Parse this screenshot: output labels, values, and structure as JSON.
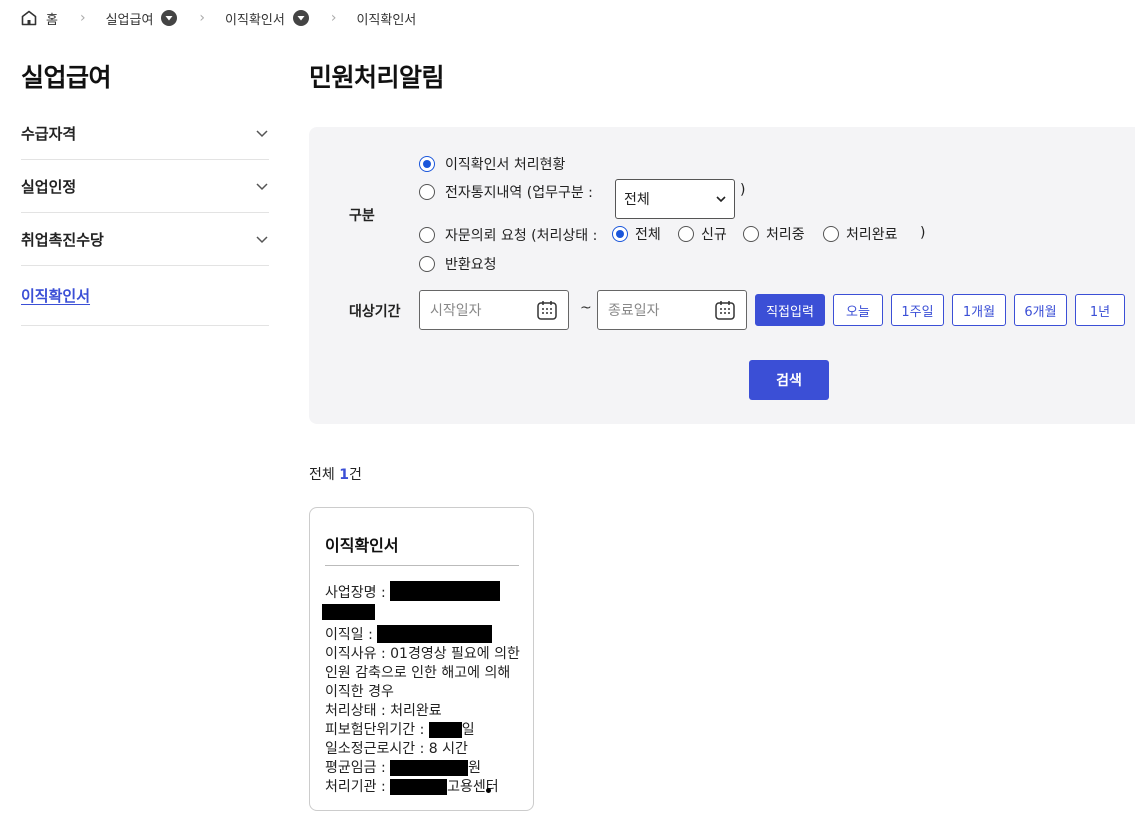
{
  "breadcrumb": {
    "home": "홈",
    "level1": "실업급여",
    "level2": "이직확인서",
    "current": "이직확인서"
  },
  "sidebar": {
    "title": "실업급여",
    "items": [
      {
        "label": "수급자격"
      },
      {
        "label": "실업인정"
      },
      {
        "label": "취업촉진수당"
      },
      {
        "label": "이직확인서"
      }
    ]
  },
  "main": {
    "title": "민원처리알림",
    "search": {
      "category_label": "구분",
      "opt1": "이직확인서 처리현황",
      "opt2_prefix": "전자통지내역 (업무구분 :",
      "opt2_select": "전체",
      "opt2_suffix": ")",
      "opt3_prefix": "자문의뢰 요청 (처리상태 :",
      "sub_all": "전체",
      "sub_new": "신규",
      "sub_progress": "처리중",
      "sub_done": "처리완료",
      "opt3_suffix": ")",
      "opt4": "반환요청",
      "period_label": "대상기간",
      "start_placeholder": "시작일자",
      "tilde": "~",
      "end_placeholder": "종료일자",
      "btn_direct": "직접입력",
      "btn_today": "오늘",
      "btn_1w": "1주일",
      "btn_1m": "1개월",
      "btn_6m": "6개월",
      "btn_1y": "1년",
      "search_btn": "검색"
    },
    "total_prefix": "전체 ",
    "total_count": "1",
    "total_suffix": "건",
    "card": {
      "title": "이직확인서",
      "biz_label": "사업장명 :",
      "retire_label": "이직일 :",
      "reason": "이직사유 : 01경영상 필요에 의한 인원 감축으로 인한 해고에 의해 이직한 경우",
      "status": "처리상태 : 처리완료",
      "insured_label": "피보험단위기간 :",
      "insured_unit": "일",
      "hours": "일소정근로시간 : 8 시간",
      "wage_label": "평균임금 :",
      "wage_unit": "원",
      "agency_label": "처리기관 :",
      "agency_suffix": "고용센터"
    }
  }
}
